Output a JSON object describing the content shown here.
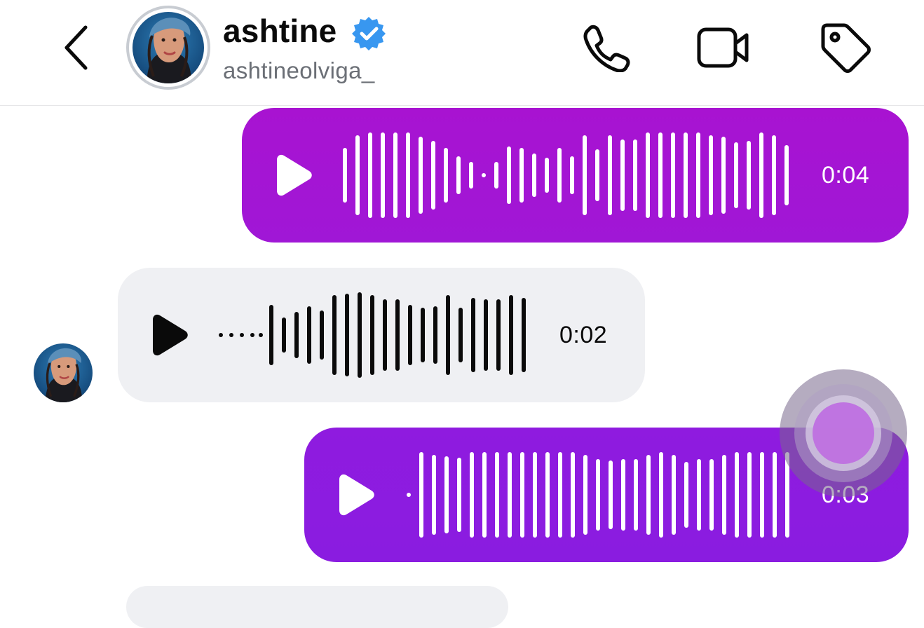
{
  "header": {
    "display_name": "ashtine",
    "username": "ashtineolviga_",
    "verified": true,
    "icons": [
      "back-arrow-icon",
      "phone-icon",
      "video-camera-icon",
      "tag-icon"
    ]
  },
  "colors": {
    "verified_badge": "#3897f0",
    "outgoing_bubble_1": "#a515d3",
    "outgoing_bubble_2": "#8c1be0",
    "incoming_bubble": "#eff0f3",
    "text_primary": "#0a0a0a",
    "text_secondary": "#6b6f76"
  },
  "messages": [
    {
      "direction": "outgoing",
      "type": "voice",
      "duration": "0:04",
      "play_icon": "play-icon"
    },
    {
      "direction": "incoming",
      "type": "voice",
      "duration": "0:02",
      "play_icon": "play-icon"
    },
    {
      "direction": "outgoing",
      "type": "voice",
      "duration": "0:03",
      "play_icon": "play-icon"
    }
  ]
}
